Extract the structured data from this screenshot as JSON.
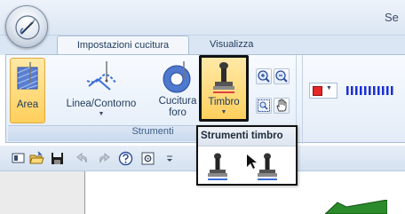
{
  "app": {
    "window_title_partial": "Se"
  },
  "tabs": {
    "active": "Impostazioni cucitura",
    "inactive": "Visualizza"
  },
  "ribbon": {
    "buttons": {
      "area": "Area",
      "linea": "Linea/Contorno",
      "cucitura_line1": "Cucitura",
      "cucitura_line2": "foro",
      "timbro": "Timbro"
    },
    "group_label": "Strumenti"
  },
  "popup": {
    "title": "Strumenti timbro"
  },
  "colors": {
    "accent_red": "#e8262a",
    "active_button": "#ffd46e",
    "stitch_blue": "#1a2fd6"
  },
  "icons": [
    "app-menu-icon",
    "area-icon",
    "line-contour-icon",
    "hole-stitch-icon",
    "stamp-icon",
    "zoom-in-icon",
    "zoom-out-icon",
    "zoom-fit-icon",
    "hand-pan-icon",
    "color-swatch-icon",
    "stitch-type-icon",
    "display-icon",
    "open-folder-icon",
    "save-icon",
    "undo-icon",
    "redo-icon",
    "help-icon",
    "settings-icon",
    "stamp-tool-icon",
    "stamp-select-icon"
  ]
}
